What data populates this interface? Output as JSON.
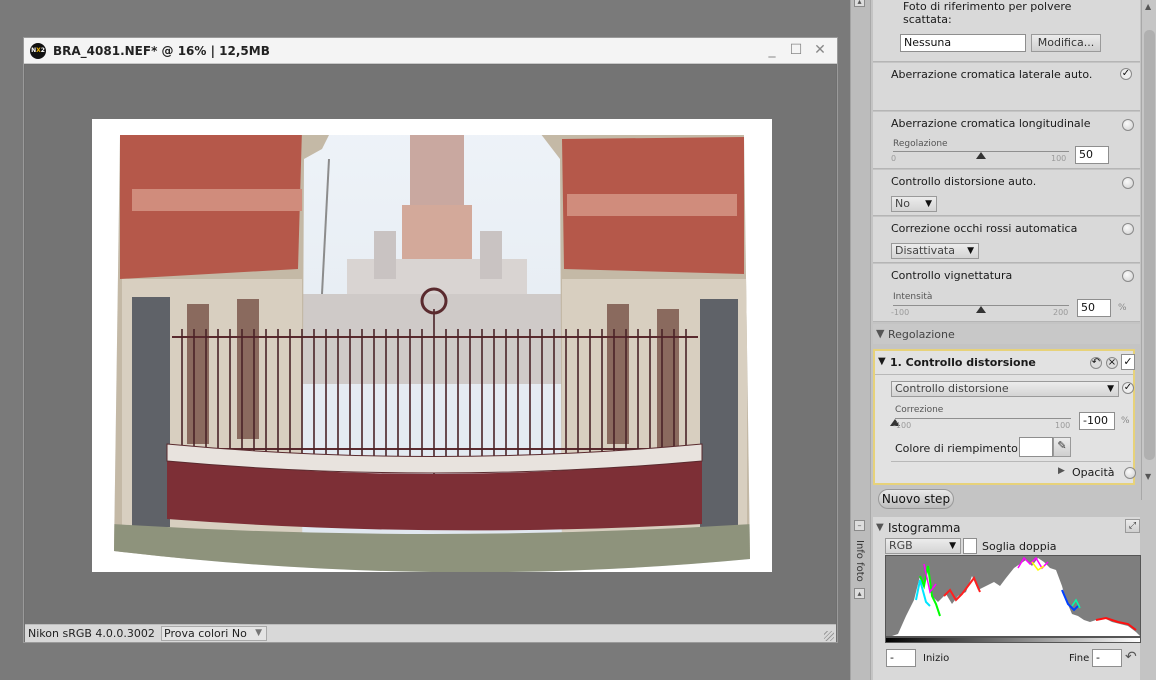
{
  "image_window": {
    "title": "BRA_4081.NEF* @ 16% | 12,5MB",
    "logo": [
      "N",
      "X",
      "2"
    ],
    "controls": {
      "minimize": "_",
      "maximize": "☐",
      "close": "✕"
    },
    "status_profile": "Nikon sRGB 4.0.0.3002",
    "proof_colors": "Prova colori No"
  },
  "panel": {
    "dust": {
      "label": "Foto di riferimento per polvere scattata:",
      "value": "Nessuna",
      "modify_button": "Modifica..."
    },
    "lateral_ca": {
      "label": "Aberrazione cromatica laterale auto.",
      "checked": "✓"
    },
    "longitudinal_ca": {
      "label": "Aberrazione cromatica longitudinale",
      "slider_label": "Regolazione",
      "min": "0",
      "max": "100",
      "value": "50",
      "level": 0.5
    },
    "auto_distortion": {
      "label": "Controllo distorsione auto.",
      "value": "No"
    },
    "red_eye": {
      "label": "Correzione occhi rossi automatica",
      "value": "Disattivata"
    },
    "vignette": {
      "label": "Controllo vignettatura",
      "slider_label": "Intensità",
      "min": "-100",
      "max": "200",
      "value": "50",
      "unit": "%",
      "level": 0.5
    },
    "adjust_header": "Regolazione",
    "step": {
      "title": "1. Controllo distorsione",
      "undo_icon": "↶",
      "delete_icon": "×",
      "checked": "✓",
      "mode": "Controllo distorsione",
      "mode_checked": "✓",
      "slider_label": "Correzione",
      "min": "-100",
      "max": "100",
      "value": "-100",
      "unit": "%",
      "level": 0.0,
      "fill_label": "Colore di riempimento",
      "opacity_label": "Opacità"
    },
    "new_step_button": "Nuovo step",
    "histogram": {
      "title": "Istogramma",
      "channel": "RGB",
      "double_threshold": "Soglia doppia",
      "start_label": "Inizio",
      "end_label": "Fine",
      "start_value": "-",
      "end_value": "-"
    },
    "info_tab": "Info foto"
  },
  "colors": {
    "window_bg": "#7a7a7a",
    "panel_bg": "#c4c4c4",
    "step_border": "#e7d27a"
  }
}
